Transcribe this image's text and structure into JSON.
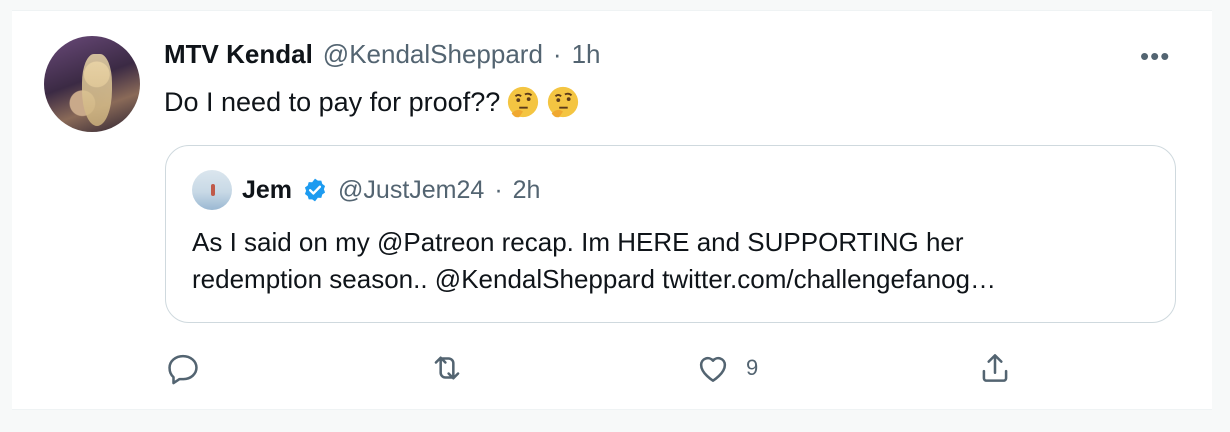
{
  "tweet": {
    "author_name": "MTV Kendal",
    "author_handle": "@KendalSheppard",
    "separator": "·",
    "time": "1h",
    "text": "Do I need to pay for proof??",
    "emojis": [
      "thinking-face-emoji",
      "thinking-face-emoji"
    ],
    "more_icon": "more-horizontal-icon"
  },
  "quote": {
    "author_name": "Jem",
    "verified_icon": "verified-badge-icon",
    "author_handle": "@JustJem24",
    "separator": "·",
    "time": "2h",
    "line1": "As I said on my @Patreon recap. Im HERE and SUPPORTING her",
    "line2": "redemption season.. @KendalSheppard twitter.com/challengefanog…"
  },
  "actions": {
    "reply_icon": "reply-icon",
    "retweet_icon": "retweet-icon",
    "like_icon": "like-icon",
    "like_count": "9",
    "share_icon": "share-icon"
  },
  "colors": {
    "text": "#0f1419",
    "secondary": "#536471",
    "verified": "#1d9bf0",
    "border": "#cfd9de",
    "emoji": "#f4c542"
  }
}
